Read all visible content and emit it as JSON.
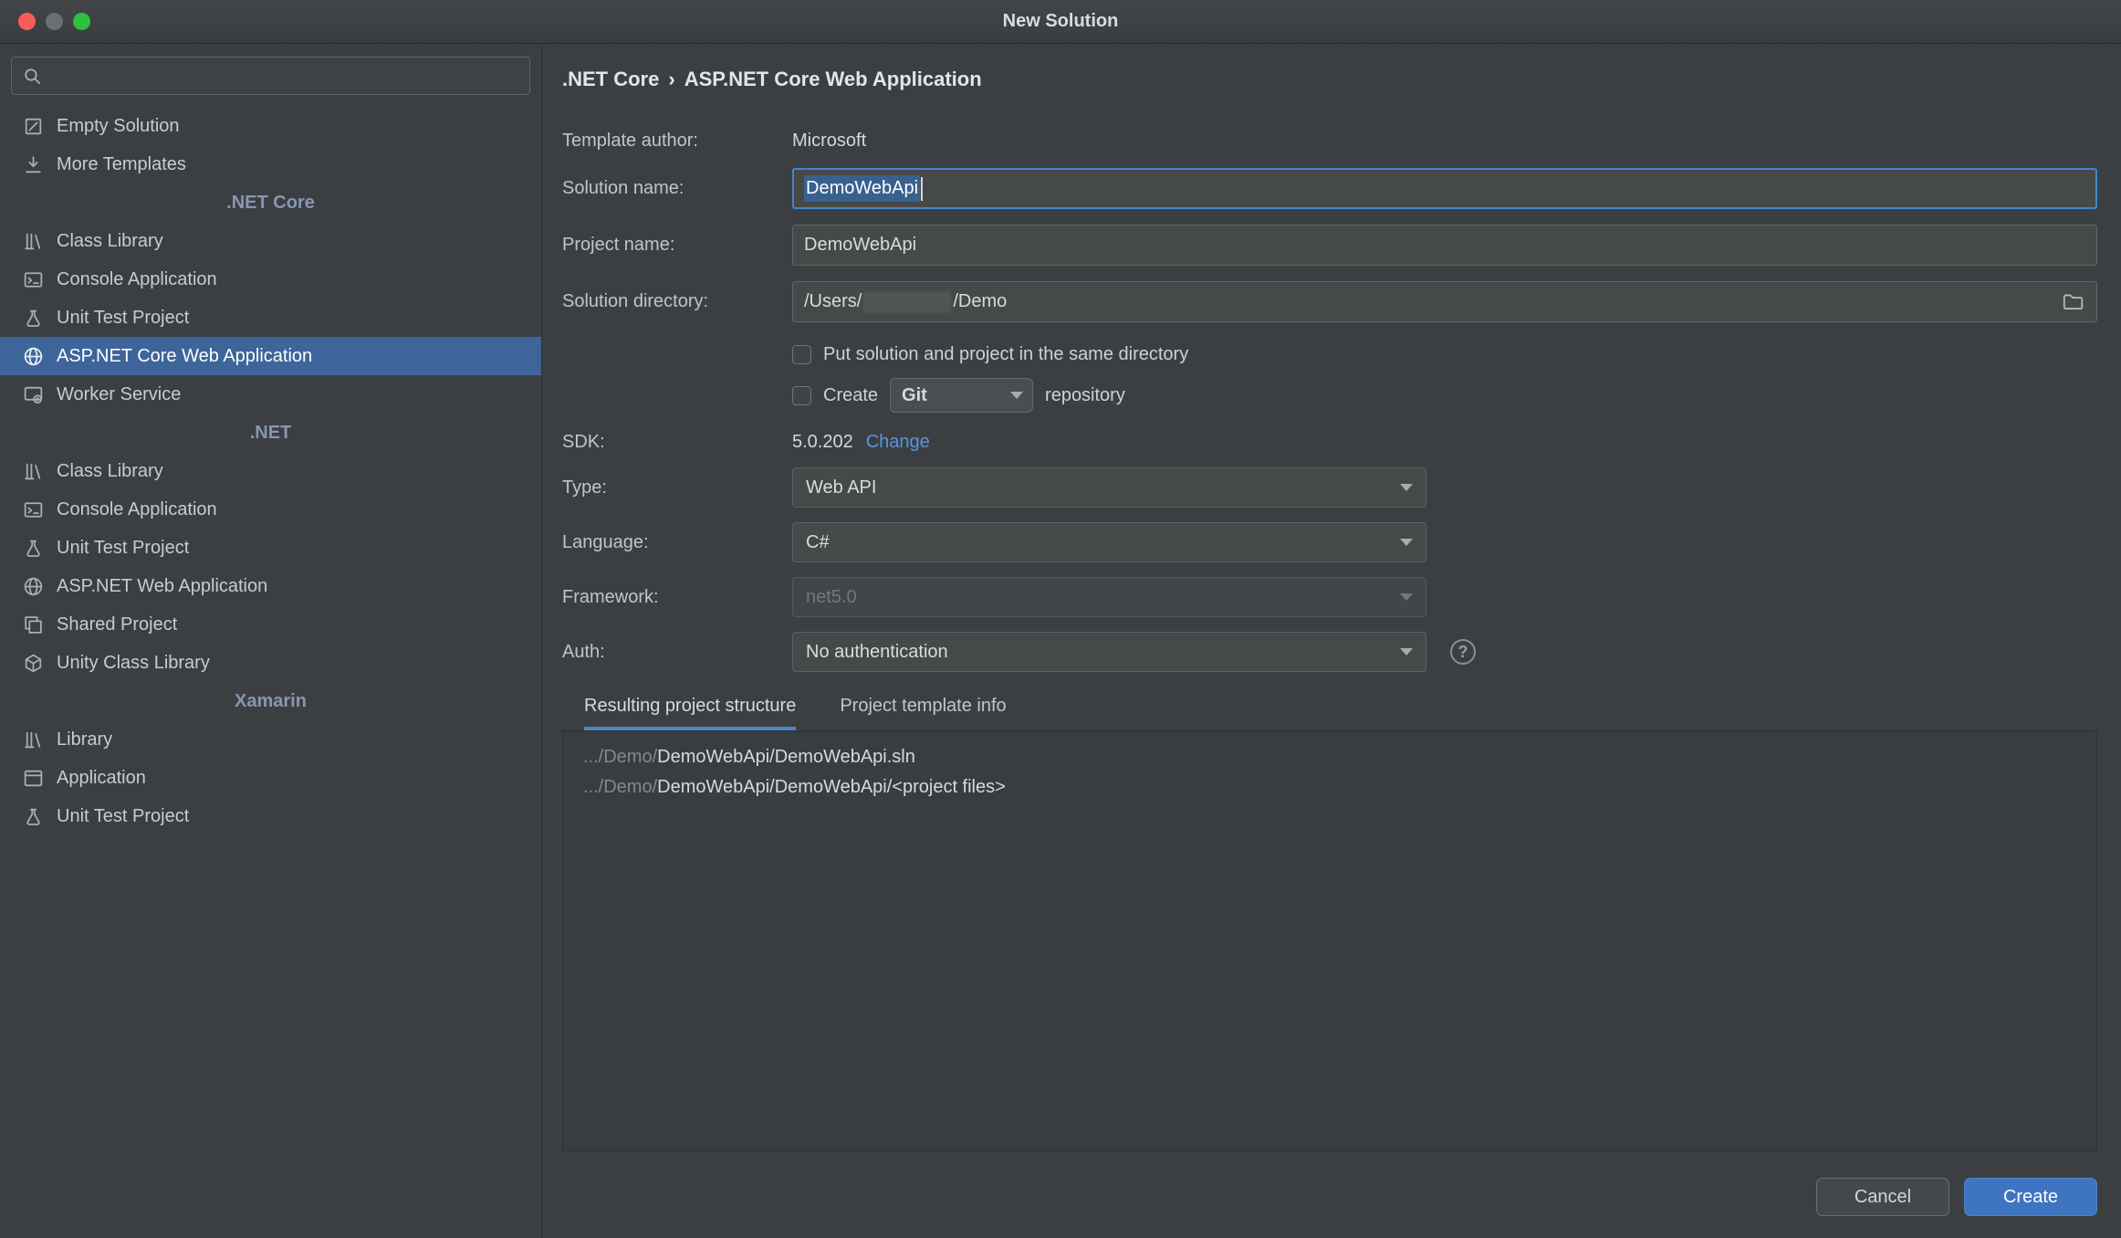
{
  "titlebar": {
    "title": "New Solution"
  },
  "sidebar": {
    "search": {
      "placeholder": ""
    },
    "items": [
      {
        "type": "item",
        "icon": "empty-solution-icon",
        "label": "Empty Solution",
        "selected": false
      },
      {
        "type": "item",
        "icon": "download-icon",
        "label": "More Templates",
        "selected": false
      },
      {
        "type": "header",
        "label": ".NET Core"
      },
      {
        "type": "item",
        "icon": "class-library-icon",
        "label": "Class Library",
        "selected": false
      },
      {
        "type": "item",
        "icon": "console-icon",
        "label": "Console Application",
        "selected": false
      },
      {
        "type": "item",
        "icon": "unit-test-icon",
        "label": "Unit Test Project",
        "selected": false
      },
      {
        "type": "item",
        "icon": "globe-icon",
        "label": "ASP.NET Core Web Application",
        "selected": true
      },
      {
        "type": "item",
        "icon": "worker-icon",
        "label": "Worker Service",
        "selected": false
      },
      {
        "type": "header",
        "label": ".NET"
      },
      {
        "type": "item",
        "icon": "class-library-icon",
        "label": "Class Library",
        "selected": false
      },
      {
        "type": "item",
        "icon": "console-icon",
        "label": "Console Application",
        "selected": false
      },
      {
        "type": "item",
        "icon": "unit-test-icon",
        "label": "Unit Test Project",
        "selected": false
      },
      {
        "type": "item",
        "icon": "globe-icon",
        "label": "ASP.NET Web Application",
        "selected": false
      },
      {
        "type": "item",
        "icon": "shared-project-icon",
        "label": "Shared Project",
        "selected": false
      },
      {
        "type": "item",
        "icon": "unity-icon",
        "label": "Unity Class Library",
        "selected": false
      },
      {
        "type": "header",
        "label": "Xamarin"
      },
      {
        "type": "item",
        "icon": "class-library-icon",
        "label": "Library",
        "selected": false
      },
      {
        "type": "item",
        "icon": "application-icon",
        "label": "Application",
        "selected": false
      },
      {
        "type": "item",
        "icon": "unit-test-icon",
        "label": "Unit Test Project",
        "selected": false
      }
    ]
  },
  "main": {
    "breadcrumb": {
      "parent": ".NET Core",
      "separator": "›",
      "current": "ASP.NET Core Web Application"
    },
    "fields": {
      "template_author": {
        "label": "Template author:",
        "value": "Microsoft"
      },
      "solution_name": {
        "label": "Solution name:",
        "value": "DemoWebApi",
        "focused": true,
        "text_selected": true
      },
      "project_name": {
        "label": "Project name:",
        "value": "DemoWebApi"
      },
      "solution_directory": {
        "label": "Solution directory:",
        "value_prefix": "/Users/",
        "value_suffix": "/Demo",
        "redacted_segment": true
      },
      "same_directory_checkbox": {
        "label": "Put solution and project in the same directory",
        "checked": false
      },
      "create_repo": {
        "prefix_label": "Create",
        "vcs_value": "Git",
        "suffix_label": "repository",
        "checked": false
      },
      "sdk": {
        "label": "SDK:",
        "value": "5.0.202",
        "change_link": "Change"
      },
      "type": {
        "label": "Type:",
        "value": "Web API"
      },
      "language": {
        "label": "Language:",
        "value": "C#"
      },
      "framework": {
        "label": "Framework:",
        "value": "net5.0",
        "disabled": true
      },
      "auth": {
        "label": "Auth:",
        "value": "No authentication",
        "help_glyph": "?"
      }
    },
    "tabs": [
      {
        "label": "Resulting project structure",
        "active": true
      },
      {
        "label": "Project template info",
        "active": false
      }
    ],
    "structure": {
      "lines": [
        {
          "muted": ".../Demo/",
          "emphasis": "DemoWebApi/DemoWebApi.sln"
        },
        {
          "muted": ".../Demo/",
          "emphasis": "DemoWebApi/DemoWebApi/<project files>"
        }
      ]
    },
    "footer": {
      "cancel_label": "Cancel",
      "create_label": "Create"
    }
  },
  "colors": {
    "dialog_background": "#3c3f41",
    "selection": "#3d6599",
    "focus_border": "#4186cd",
    "tab_accent": "#4a86c8",
    "link": "#5596dd",
    "create_button": "#3f74c0",
    "traffic_red": "#f85e57",
    "traffic_gray": "#6b6f71",
    "traffic_green": "#2fc03f"
  }
}
